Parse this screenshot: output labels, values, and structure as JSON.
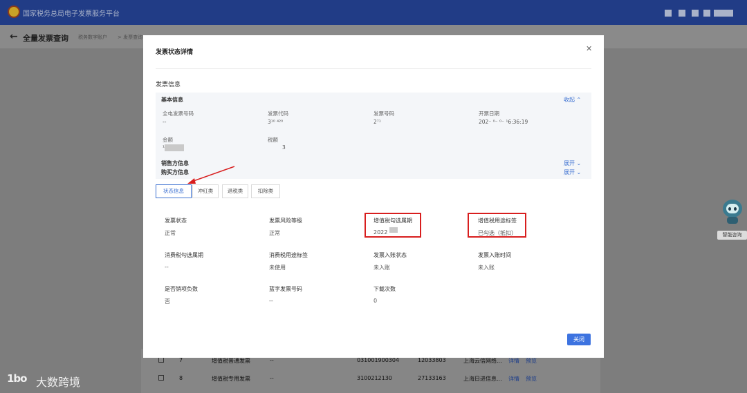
{
  "topbar": {
    "title": "国家税务总局电子发票服务平台"
  },
  "page": {
    "title": "全量发票查询",
    "breadcrumb": [
      "税务数字账户",
      "> 发票查询"
    ]
  },
  "background_table": {
    "rows": [
      {
        "index": "7",
        "type": "增值税普通发票",
        "dash": "--",
        "code": "031001900304",
        "number": "12033803",
        "seller": "上海云信网络...",
        "actions": [
          "详情",
          "预览"
        ]
      },
      {
        "index": "8",
        "type": "增值税专用发票",
        "dash": "--",
        "code": "3100212130",
        "number": "27133163",
        "seller": "上海日进信息...",
        "actions": [
          "详情",
          "预览"
        ]
      }
    ]
  },
  "assistant": {
    "label": "智能咨询"
  },
  "watermark": {
    "logo": "1bo",
    "text": "大数跨境"
  },
  "modal": {
    "title": "发票状态详情",
    "section_title": "发票信息",
    "basic": {
      "head": "基本信息",
      "collapse": "收起",
      "fields": [
        {
          "label": "全电发票号码",
          "value": "--"
        },
        {
          "label": "发票代码",
          "value": "3¹⁰ ⁴²⁰"
        },
        {
          "label": "发票号码",
          "value": "2⁷¹"
        },
        {
          "label": "开票日期",
          "value": "202⁻ ⁰⁻ ⁰⁻ ¹6:36:19"
        },
        {
          "label": "金额",
          "value": "¹"
        },
        {
          "label": "税额",
          "value": "3"
        }
      ]
    },
    "seller": {
      "head": "销售方信息",
      "expand": "展开"
    },
    "buyer": {
      "head": "购买方信息",
      "expand": "展开"
    },
    "tabs": [
      {
        "label": "状态信息",
        "active": true
      },
      {
        "label": "冲红类",
        "active": false
      },
      {
        "label": "退税类",
        "active": false
      },
      {
        "label": "扣除类",
        "active": false
      }
    ],
    "status": [
      {
        "label": "发票状态",
        "value": "正常"
      },
      {
        "label": "发票风险等级",
        "value": "正常"
      },
      {
        "label": "增值税勾选属期",
        "value": "2022"
      },
      {
        "label": "增值税用途标签",
        "value": "已勾选（抵扣）"
      },
      {
        "label": "消费税勾选属期",
        "value": "--"
      },
      {
        "label": "消费税用途标签",
        "value": "未使用"
      },
      {
        "label": "发票入账状态",
        "value": "未入账"
      },
      {
        "label": "发票入账时间",
        "value": "未入账"
      },
      {
        "label": "是否销项负数",
        "value": "否"
      },
      {
        "label": "蓝字发票号码",
        "value": "--"
      },
      {
        "label": "下载次数",
        "value": "0"
      }
    ],
    "close_button": "关闭"
  },
  "colors": {
    "topbar": "#213c86",
    "primary": "#3d73e0",
    "highlight": "#d81e1e"
  }
}
